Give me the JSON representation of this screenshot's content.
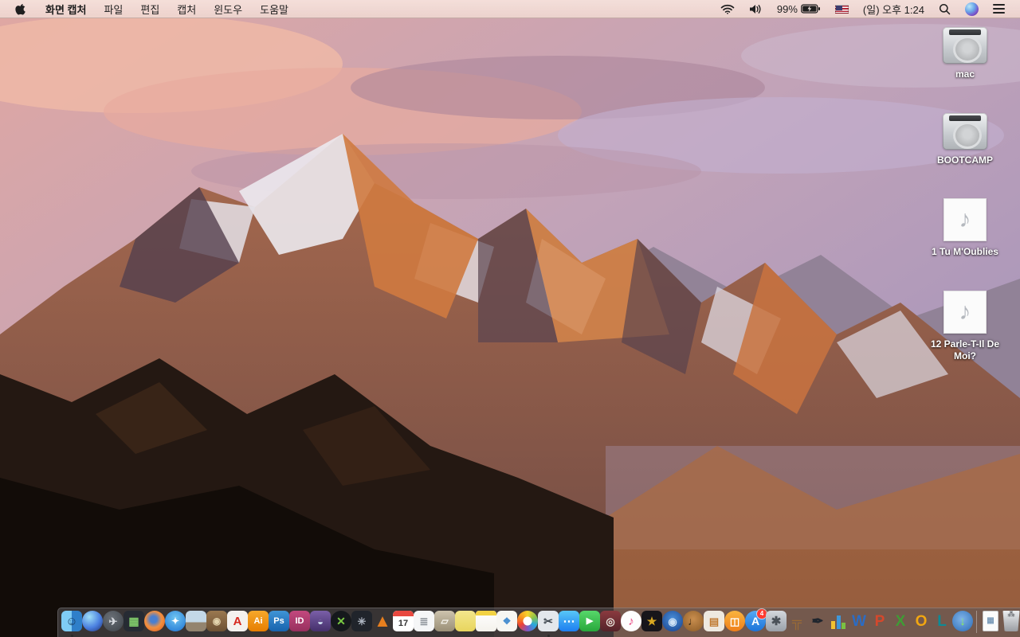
{
  "menu_bar": {
    "app_name": "화면 캡처",
    "menus": [
      "파일",
      "편집",
      "캡처",
      "윈도우",
      "도움말"
    ],
    "status": {
      "battery_percent": "99%",
      "clock": "(일) 오후 1:24",
      "icons": [
        "wifi-icon",
        "volume-icon",
        "battery-charging-icon",
        "us-flag-input-icon",
        "spotlight-search-icon",
        "siri-icon",
        "notification-center-icon"
      ]
    }
  },
  "colors": {
    "menu_bar_bg": "#f2ded8",
    "dock_bg": "rgba(88,86,90,0.55)",
    "badge_red": "#ff3b30"
  },
  "desktop": {
    "icons": [
      {
        "name": "volume-mac",
        "label": "mac",
        "kind": "hdd"
      },
      {
        "name": "volume-bootcamp",
        "label": "BOOTCAMP",
        "kind": "hdd"
      },
      {
        "name": "audio-file-1",
        "label": "1 Tu M'Oublies",
        "kind": "audio",
        "glyph": "♪"
      },
      {
        "name": "audio-file-2",
        "label": "12 Parle-T-Il De Moi?",
        "kind": "audio",
        "glyph": "♪"
      }
    ]
  },
  "dock": {
    "items": [
      {
        "name": "finder",
        "shape": "rounded",
        "bg": "linear-gradient(90deg,#7fccf5 0 50%,#2f7fc9 50% 100%)",
        "glyph": "☺",
        "color": "#17395c",
        "size": 15,
        "running": true
      },
      {
        "name": "siri",
        "shape": "circle",
        "bg": "radial-gradient(circle at 35% 30%,#9fe0f7,#4a7fe0 55%,#22306e)",
        "glyph": ""
      },
      {
        "name": "launchpad",
        "shape": "circle",
        "bg": "radial-gradient(circle at 40% 35%,#6a7077,#3c4147)",
        "glyph": "✈",
        "color": "#d8dbe0",
        "size": 13
      },
      {
        "name": "mission-control",
        "shape": "rounded",
        "bg": "#262b33",
        "glyph": "▦",
        "color": "#7fc96a",
        "size": 14
      },
      {
        "name": "firefox",
        "shape": "circle",
        "bg": "radial-gradient(circle at 45% 42%,#4a7fd0 20%,#f29040 50%,#da561c)",
        "glyph": ""
      },
      {
        "name": "safari",
        "shape": "circle",
        "bg": "radial-gradient(circle at 50% 35%,#6fc5f2,#1d72d2)",
        "glyph": "✦",
        "color": "#ffffff",
        "size": 12
      },
      {
        "name": "preview",
        "shape": "rounded",
        "bg": "linear-gradient(180deg,#c3d8e8 0 55%,#93846f 55% 100%)",
        "glyph": ""
      },
      {
        "name": "contacts",
        "shape": "rounded",
        "bg": "linear-gradient(180deg,#9a7850,#6e5234)",
        "glyph": "◉",
        "color": "#e3d3ac",
        "size": 12
      },
      {
        "name": "acrobat-reader",
        "shape": "rounded",
        "bg": "#f4f1ee",
        "glyph": "A",
        "color": "#d6281e",
        "size": 15
      },
      {
        "name": "adobe-illustrator",
        "shape": "rounded",
        "bg": "linear-gradient(180deg,#f7a82b,#e67e00)",
        "glyph": "Ai",
        "color": "#ffffff",
        "size": 11
      },
      {
        "name": "adobe-photoshop",
        "shape": "rounded",
        "bg": "linear-gradient(180deg,#3f94d6,#1763ad)",
        "glyph": "Ps",
        "color": "#ffffff",
        "size": 11
      },
      {
        "name": "adobe-indesign",
        "shape": "rounded",
        "bg": "linear-gradient(180deg,#c2487e,#98305e)",
        "glyph": "ID",
        "color": "#ffffff",
        "size": 11
      },
      {
        "name": "toast-titanium",
        "shape": "rounded",
        "bg": "linear-gradient(180deg,#7a5fa8,#45306b)",
        "glyph": "◒",
        "color": "#cfe2f2",
        "size": 13
      },
      {
        "name": "xee-image-viewer",
        "shape": "circle",
        "bg": "#15181c",
        "glyph": "✕",
        "color": "#79c843",
        "size": 14
      },
      {
        "name": "fan-disc-utility",
        "shape": "rounded",
        "bg": "#20242b",
        "glyph": "✳",
        "color": "#aeb6c2",
        "size": 13
      },
      {
        "name": "vlc",
        "shape": "plain",
        "glyph": "▲",
        "color": "#e87f1e",
        "size": 22
      },
      {
        "name": "calendar",
        "shape": "cal",
        "glyph": "17",
        "color": "#333333",
        "size": 11
      },
      {
        "name": "reminders",
        "shape": "rounded",
        "bg": "#f5f6f7",
        "glyph": "≣",
        "color": "#8a8f96",
        "size": 13
      },
      {
        "name": "unarchiver",
        "shape": "rounded",
        "bg": "linear-gradient(180deg,#cdc3ad,#9a8f77)",
        "glyph": "▱",
        "color": "#f7f5ef",
        "size": 12
      },
      {
        "name": "stickies",
        "shape": "rounded",
        "bg": "linear-gradient(180deg,#f3e78c,#e8d55e)",
        "glyph": ""
      },
      {
        "name": "notes",
        "shape": "note",
        "glyph": ""
      },
      {
        "name": "certificate-document",
        "shape": "rounded",
        "bg": "#f7f6f2",
        "glyph": "❖",
        "color": "#4a8fd0",
        "size": 12
      },
      {
        "name": "photos",
        "shape": "circle",
        "bg": "radial-gradient(circle,#ffffff 29%,rgba(255,255,255,0) 31%),conic-gradient(#f6d32d,#8bc34a,#26a9e0,#7e57c2,#ef4136,#f7941e,#f6d32d)",
        "glyph": ""
      },
      {
        "name": "grab-screen-capture",
        "shape": "rounded",
        "bg": "#e3e7ec",
        "glyph": "✂",
        "color": "#3f4750",
        "size": 14,
        "running": true
      },
      {
        "name": "messages",
        "shape": "rounded",
        "bg": "linear-gradient(180deg,#58c7f7,#1d7ef0)",
        "glyph": "⋯",
        "color": "#ffffff",
        "size": 15
      },
      {
        "name": "facetime",
        "shape": "rounded",
        "bg": "linear-gradient(180deg,#57d76a,#28a83c)",
        "glyph": "▶",
        "color": "#ffffff",
        "size": 11
      },
      {
        "name": "photo-booth",
        "shape": "rounded",
        "bg": "linear-gradient(180deg,#8a3a3f,#55242a)",
        "glyph": "◎",
        "color": "#e8e3da",
        "size": 13
      },
      {
        "name": "itunes",
        "shape": "circle",
        "bg": "#fdfdfd",
        "glyph": "♪",
        "color": "#e8447f",
        "size": 15
      },
      {
        "name": "imovie",
        "shape": "rounded",
        "bg": "#17151a",
        "glyph": "★",
        "color": "#d9a821",
        "size": 14
      },
      {
        "name": "dvd-player",
        "shape": "circle",
        "bg": "radial-gradient(circle at 50% 40%,#4a8fd9,#173f8a)",
        "glyph": "◉",
        "color": "#cfe2f5",
        "size": 13
      },
      {
        "name": "garageband",
        "shape": "circle",
        "bg": "radial-gradient(circle at 50% 40%,#c98e4e,#8a5a26)",
        "glyph": "♩",
        "color": "#3f2a12",
        "size": 14
      },
      {
        "name": "newsletter-collage",
        "shape": "rounded",
        "bg": "#eee9df",
        "glyph": "▤",
        "color": "#c07a30",
        "size": 13
      },
      {
        "name": "ibooks",
        "shape": "circle",
        "bg": "linear-gradient(180deg,#f9b43f,#ef7f1a)",
        "glyph": "◫",
        "color": "#ffffff",
        "size": 13
      },
      {
        "name": "app-store",
        "shape": "circle",
        "bg": "linear-gradient(180deg,#55a8f2,#1c74d9)",
        "glyph": "A",
        "color": "#ffffff",
        "size": 14,
        "badge": "4"
      },
      {
        "name": "system-preferences",
        "shape": "rounded",
        "bg": "linear-gradient(180deg,#d3d7dc,#9aa0a8)",
        "glyph": "✱",
        "color": "#4b5158",
        "size": 15
      },
      {
        "name": "keynote",
        "shape": "plain",
        "glyph": "╦",
        "color": "#9a6a35",
        "size": 17
      },
      {
        "name": "pages",
        "shape": "plain",
        "glyph": "✒",
        "color": "#20262e",
        "size": 18
      },
      {
        "name": "numbers",
        "shape": "bars",
        "glyph": ""
      },
      {
        "name": "microsoft-word",
        "shape": "plain",
        "glyph": "W",
        "color": "#2b6cc4",
        "size": 19
      },
      {
        "name": "microsoft-powerpoint",
        "shape": "plain",
        "glyph": "P",
        "color": "#d5482c",
        "size": 19
      },
      {
        "name": "microsoft-excel",
        "shape": "plain",
        "glyph": "X",
        "color": "#3f9c35",
        "size": 19
      },
      {
        "name": "microsoft-outlook",
        "shape": "plain",
        "glyph": "O",
        "color": "#f2a711",
        "size": 19
      },
      {
        "name": "microsoft-lync",
        "shape": "plain",
        "glyph": "L",
        "color": "#0d8a96",
        "size": 19
      },
      {
        "name": "web-downloader",
        "shape": "circle",
        "bg": "radial-gradient(circle at 45% 40%,#7fb3e8,#2a6ab5)",
        "glyph": "↓",
        "color": "#8ef05a",
        "size": 15
      },
      {
        "name": "divider",
        "shape": "divider"
      },
      {
        "name": "image-file",
        "shape": "doc",
        "glyph": "▦",
        "color": "#7a9ab8",
        "size": 10
      },
      {
        "name": "trash-full",
        "shape": "trash",
        "glyph": "⁂",
        "color": "#74777c",
        "size": 9
      }
    ]
  }
}
